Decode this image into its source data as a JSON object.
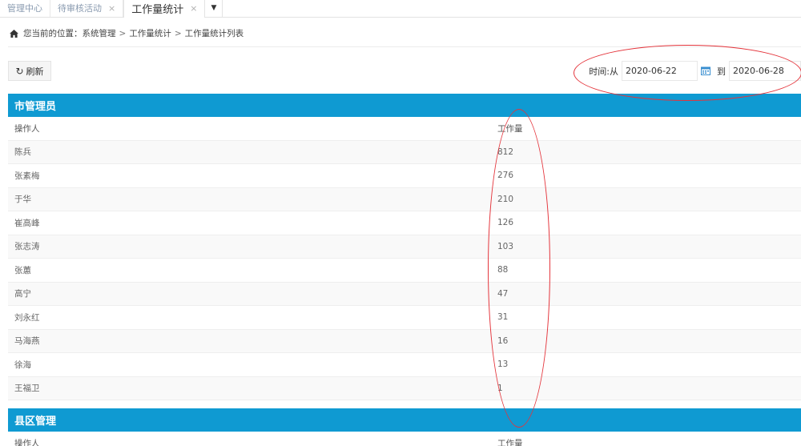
{
  "tabs": [
    {
      "label": "管理中心",
      "closable": false,
      "active": false
    },
    {
      "label": "待审核活动",
      "closable": true,
      "active": false
    },
    {
      "label": "工作量统计",
      "closable": true,
      "active": true
    }
  ],
  "tab_close_glyph": "×",
  "tab_dropdown_glyph": "▼",
  "breadcrumb": {
    "prefix": "您当前的位置：",
    "items": [
      "系统管理",
      "工作量统计",
      "工作量统计列表"
    ],
    "separator": ">"
  },
  "toolbar": {
    "refresh_label": "刷新",
    "refresh_icon": "refresh-icon",
    "date_from_label": "时间:从",
    "date_from_value": "2020-06-22",
    "date_to_label": "到",
    "date_to_value": "2020-06-28"
  },
  "sections": [
    {
      "title": "市管理员",
      "columns": [
        "操作人",
        "工作量"
      ],
      "rows": [
        [
          "陈兵",
          "812"
        ],
        [
          "张素梅",
          "276"
        ],
        [
          "于华",
          "210"
        ],
        [
          "崔高峰",
          "126"
        ],
        [
          "张志涛",
          "103"
        ],
        [
          "张蕙",
          "88"
        ],
        [
          "高宁",
          "47"
        ],
        [
          "刘永红",
          "31"
        ],
        [
          "马海燕",
          "16"
        ],
        [
          "徐海",
          "13"
        ],
        [
          "王福卫",
          "1"
        ]
      ]
    },
    {
      "title": "县区管理",
      "columns": [
        "操作人",
        "工作量"
      ],
      "rows": []
    }
  ],
  "colors": {
    "section_header": "#0f9ad2",
    "annotation": "#e4343b"
  }
}
